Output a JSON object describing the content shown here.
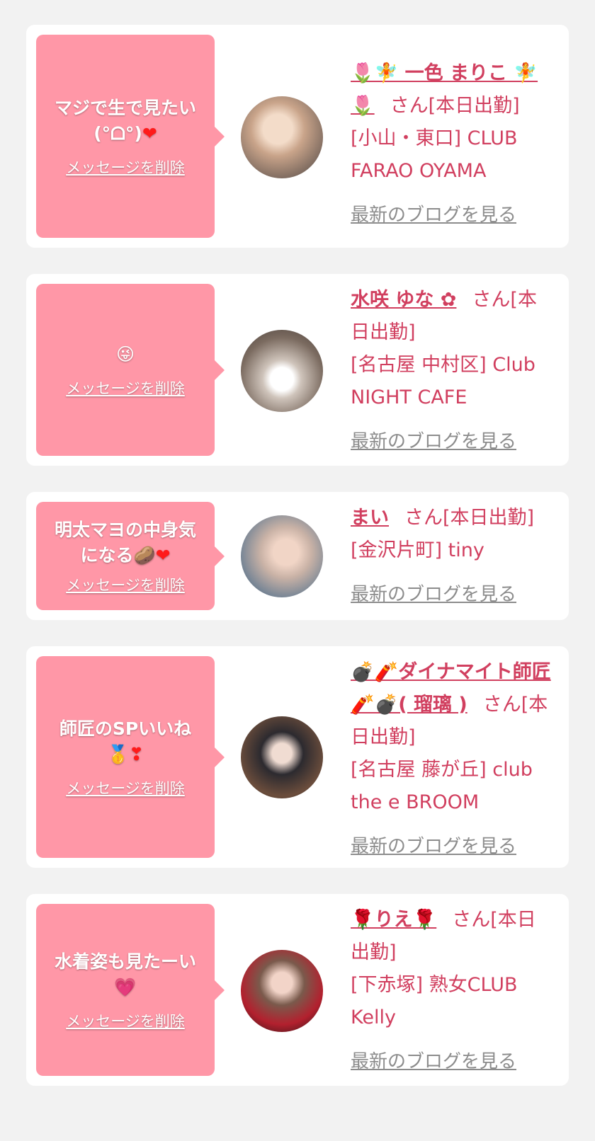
{
  "colors": {
    "accent": "#d13f5f",
    "bubble": "#ff97a7",
    "link_gray": "#8c8c8c",
    "background": "#f2f2f2"
  },
  "delete_label": "メッセージを削除",
  "blog_label": "最新のブログを見る",
  "cards": [
    {
      "message": "マジで生で見たい\n(°ᗝ°)",
      "message_emoji": "❤",
      "name": "🌷🧚 一色 まりこ 🧚🌷",
      "suffix": "さん[本日出勤]",
      "shop": "[小山・東口] CLUB FARAO OYAMA"
    },
    {
      "message": "😜",
      "message_emoji": "",
      "name": "水咲 ゆな ✿",
      "suffix": "さん[本日出勤]",
      "shop": "[名古屋 中村区] Club NIGHT CAFE"
    },
    {
      "message": "明太マヨの中身気\nになる🥔",
      "message_emoji": "❤",
      "name": "まい",
      "suffix": "さん[本日出勤]",
      "shop": "[金沢片町] tiny"
    },
    {
      "message": "師匠のSPいいね\n🥇",
      "message_emoji": "❣",
      "name": "💣🧨ダイナマイト師匠🧨💣( 瑠璃 )",
      "suffix": "さん[本日出勤]",
      "shop": "[名古屋 藤が丘] club the e BROOM"
    },
    {
      "message": "水着姿も見たーい\n💗",
      "message_emoji": "",
      "name": "🌹りえ🌹",
      "suffix": "さん[本日出勤]",
      "shop": "[下赤塚] 熟女CLUB Kelly"
    }
  ]
}
